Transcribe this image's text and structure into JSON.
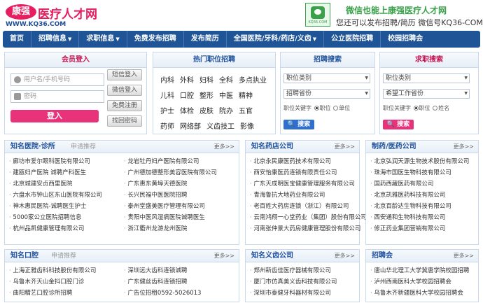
{
  "header": {
    "logo_badge": "康强",
    "logo_name": "医疗人才网",
    "logo_url": "WWW.KQ36.COM",
    "wechat_label": "KQ36.COM",
    "line1": "微信也能上康强医疗人才网",
    "line2": "您还可以发布招聘/简历 微信号KQ36-COM"
  },
  "nav": [
    {
      "label": "首页"
    },
    {
      "label": "招聘信息",
      "caret": "▼"
    },
    {
      "label": "求职信息",
      "caret": "▼"
    },
    {
      "label": "免费发布招聘"
    },
    {
      "label": "发布简历"
    },
    {
      "label": "全国医院/牙科/药店/义齿",
      "caret": "▼"
    },
    {
      "label": "公立医院招聘"
    },
    {
      "label": "校园招聘会"
    }
  ],
  "login": {
    "title": "会员登入",
    "user_placeholder": "用户名/手机号码",
    "pass_placeholder": "密码",
    "login_button": "登入",
    "side_buttons": [
      "短信登入",
      "微信登入",
      "免费注册",
      "找回密码"
    ]
  },
  "hot_jobs": {
    "title": "热门职位招聘",
    "rows": [
      [
        "内科",
        "外科",
        "妇科",
        "全科",
        "多点执业"
      ],
      [
        "儿科",
        "口腔",
        "整形",
        "中医",
        "精神"
      ],
      [
        "护士",
        "体检",
        "皮肤",
        "院办",
        "五官"
      ],
      [
        "药师",
        "网络部",
        "义齿技工",
        "影像"
      ]
    ]
  },
  "job_search": {
    "title": "招聘搜索",
    "select1": "职位类别",
    "select2": "招聘省份",
    "keyword_label": "职位关键字",
    "radio1": "职位",
    "radio2": "单位",
    "button": "搜索"
  },
  "resume_search": {
    "title": "求职搜索",
    "select1": "职位类别",
    "select2": "希望工作省份",
    "keyword_label": "职位关键字",
    "radio1": "职位",
    "radio2": "姓名",
    "button": "搜索"
  },
  "lists": {
    "hospitals": {
      "title": "知名医院·诊所",
      "sub": "申请推荐",
      "more": "更多>>",
      "col1": [
        "廊坊市爱尔眼科医院有限公司",
        "建瓯妇产医院 诚聘产科医生",
        "北京城建安贞西里医院",
        "六盘水市钟山区东山医院有限公司",
        "神木惠民医院-诚聘医生护士",
        "5000家公立医院招聘信息",
        "杭州品凯健康管理有限公司"
      ],
      "col2": [
        "龙岩牡丹妇产医院有限公司",
        "广州德加德整形美容医院有限公司",
        "广东惠东黄埠天德医院",
        "长兴民福中医医院招聘",
        "泰州堂盛美医疗管理有限公司",
        "贵阳中医风湿病医院诚聘医生",
        "浙江衢州龙游龙州医院"
      ]
    },
    "pharmacy": {
      "title": "知名药店公司",
      "more": "更多>>",
      "items": [
        "北京永民康医药技术有限公司",
        "西安怡康医药连锁有限责任公司",
        "广东天成明医宝健康管理服务有限公司",
        "青海鲁抗大地药业有限公司",
        "老百姓大药房连锁（浙江）有限公司",
        "云南鸿翔一心堂药业（集团）股份有限公司",
        "河南张仲景大药房健康管理股份有限公司"
      ]
    },
    "pharma": {
      "title": "制药/医药公司",
      "more": "更多>>",
      "items": [
        "北京弘润天源生物技术股份有限公司",
        "珠海市国医生物科技有限公司",
        "国药西藏医药有限公司",
        "北京凯雅医药科技有限公司",
        "北京百龄达生物科技有限公司",
        "西安通和生物科技有限公司",
        "修正药业集团营销有限公司"
      ]
    },
    "dental": {
      "title": "知名口腔",
      "sub": "申请推荐",
      "more": "更多>>",
      "col1": [
        "上海正雅齿科科技股份有限公司",
        "乌鲁木齐天山金抖口腔门诊",
        "曲阳精艺口腔诊所招聘"
      ],
      "col2": [
        "深圳远大齿科连锁诚聘",
        "广东健丝齿科连锁招聘",
        "广告位招租0592-5026013"
      ]
    },
    "denture": {
      "title": "知名义齿公司",
      "more": "更多>>",
      "items": [
        "郑州新齿佳医疗器械有限公司",
        "厦门市仿真美义齿科技有限公司",
        "深圳市泰健牙科器材有限公司"
      ]
    },
    "campus": {
      "title": "招聘会",
      "more": "更多>>",
      "items": [
        "唐山华北理工大学冀唐学院校园招聘",
        "泸州西南医科大学校园招聘会",
        "乌鲁木齐新疆医科大学校园招聘会"
      ]
    }
  }
}
